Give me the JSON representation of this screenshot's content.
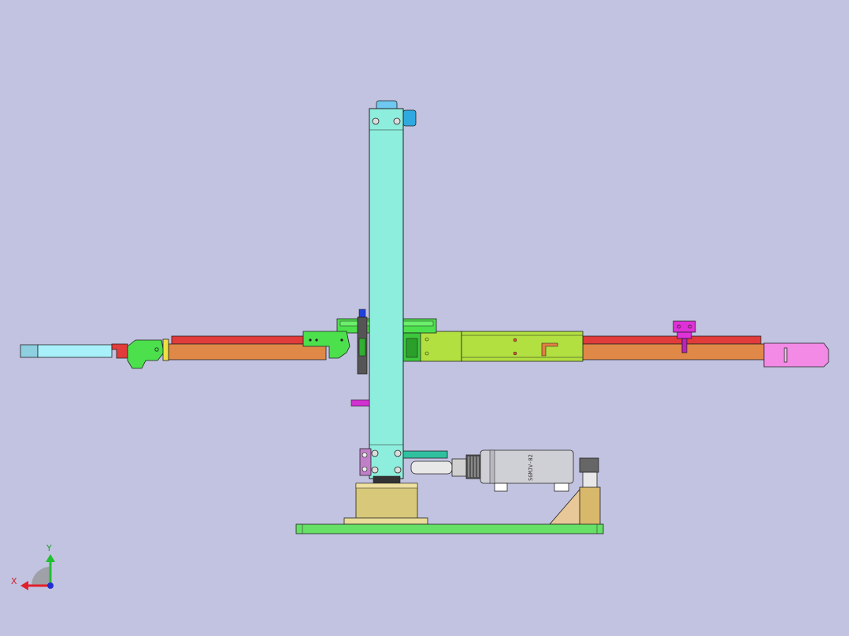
{
  "colors": {
    "background": "#c2c3e0",
    "column": "#8eeedd",
    "arm_upper_rail": "#e23b3b",
    "arm_lower_rail": "#e08848",
    "base_plate": "#66e066",
    "left_tip": "#a8f0fa",
    "gripper_left": "#4ce04c",
    "gripper_right": "#f28ae6",
    "slider_block": "#b2e040",
    "motor_body": "#cfcfd6",
    "brass": "#d8c87a",
    "axis_x": "#e0202a",
    "axis_y": "#20c030",
    "axis_z": "#2030d0"
  },
  "triad": {
    "x_label": "X",
    "y_label": "Y"
  },
  "motor_marking": "SGMJV-02"
}
